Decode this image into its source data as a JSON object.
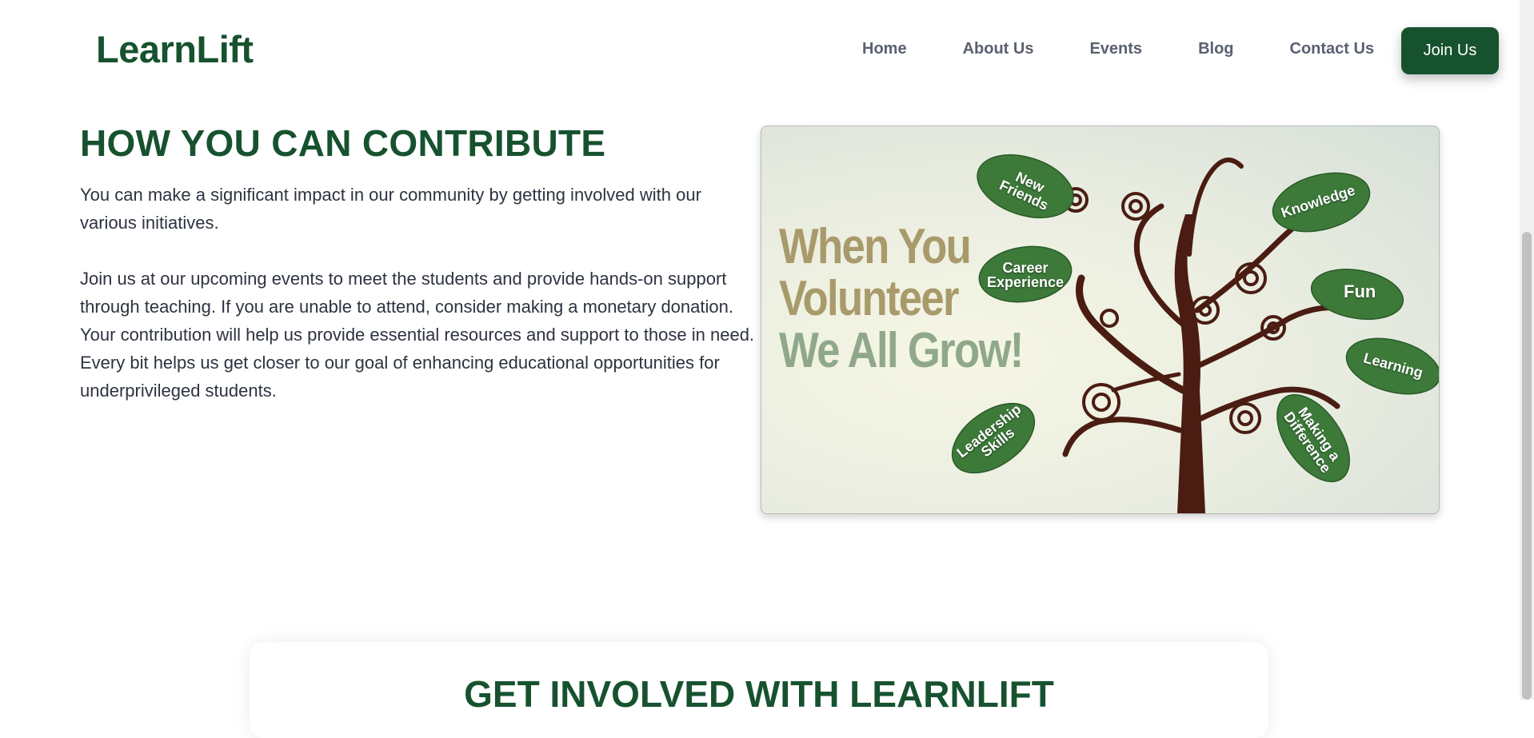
{
  "header": {
    "logo": "LearnLift",
    "nav": [
      "Home",
      "About Us",
      "Events",
      "Blog",
      "Contact Us"
    ],
    "join_label": "Join Us"
  },
  "contribute": {
    "title": "HOW YOU CAN CONTRIBUTE",
    "para1": "You can make a significant impact in our community by getting involved with our various initiatives.",
    "para2": "Join us at our upcoming events to meet the students and provide hands-on support through teaching. If you are unable to attend, consider making a monetary donation. Your contribution will help us provide essential resources and support to those in need. Every bit helps us get closer to our goal of enhancing educational opportunities for underprivileged students."
  },
  "volunteer_image": {
    "tagline": [
      "When You",
      "Volunteer",
      "We All Grow!"
    ],
    "leaves": [
      "New Friends",
      "Knowledge",
      "Career Experience",
      "Fun",
      "Learning",
      "Leadership Skills",
      "Making a Difference"
    ],
    "colors": {
      "tagline_tan": "#a89a6a",
      "tagline_green": "#8fa88a",
      "trunk": "#4a1c12",
      "leaf": "#3d7a3a"
    }
  },
  "get_involved": {
    "title": "GET INVOLVED WITH LEARNLIFT"
  },
  "colors": {
    "brand_green": "#17522f",
    "nav_text": "#5a6070",
    "body_text": "#2d3340"
  }
}
